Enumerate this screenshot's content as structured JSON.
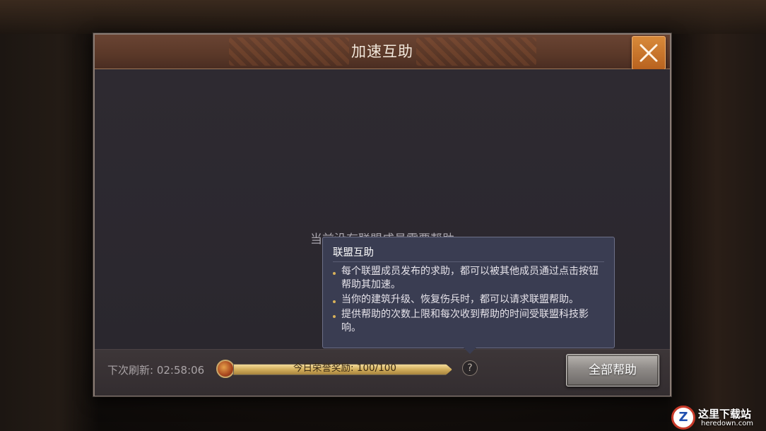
{
  "dialog": {
    "title": "加速互助",
    "close_icon": "close-icon"
  },
  "body": {
    "empty_message": "当前没有联盟成员需要帮助"
  },
  "tooltip": {
    "title": "联盟互助",
    "items": [
      "每个联盟成员发布的求助，都可以被其他成员通过点击按钮帮助其加速。",
      "当你的建筑升级、恢复伤兵时，都可以请求联盟帮助。",
      "提供帮助的次数上限和每次收到帮助的时间受联盟科技影响。"
    ]
  },
  "footer": {
    "refresh_label": "下次刷新:",
    "refresh_time": "02:58:06",
    "honor_label": "今日荣誉奖励:",
    "honor_value": "100/100",
    "honor_progress": 1.0,
    "help_icon_text": "?",
    "help_all_label": "全部帮助"
  },
  "watermark": {
    "logo": "Z",
    "name": "这里下载站",
    "url": "heredown.com"
  },
  "colors": {
    "accent": "#d88a3a",
    "progress": "#d2ae5c",
    "tooltip_bg": "#3a3d52"
  }
}
